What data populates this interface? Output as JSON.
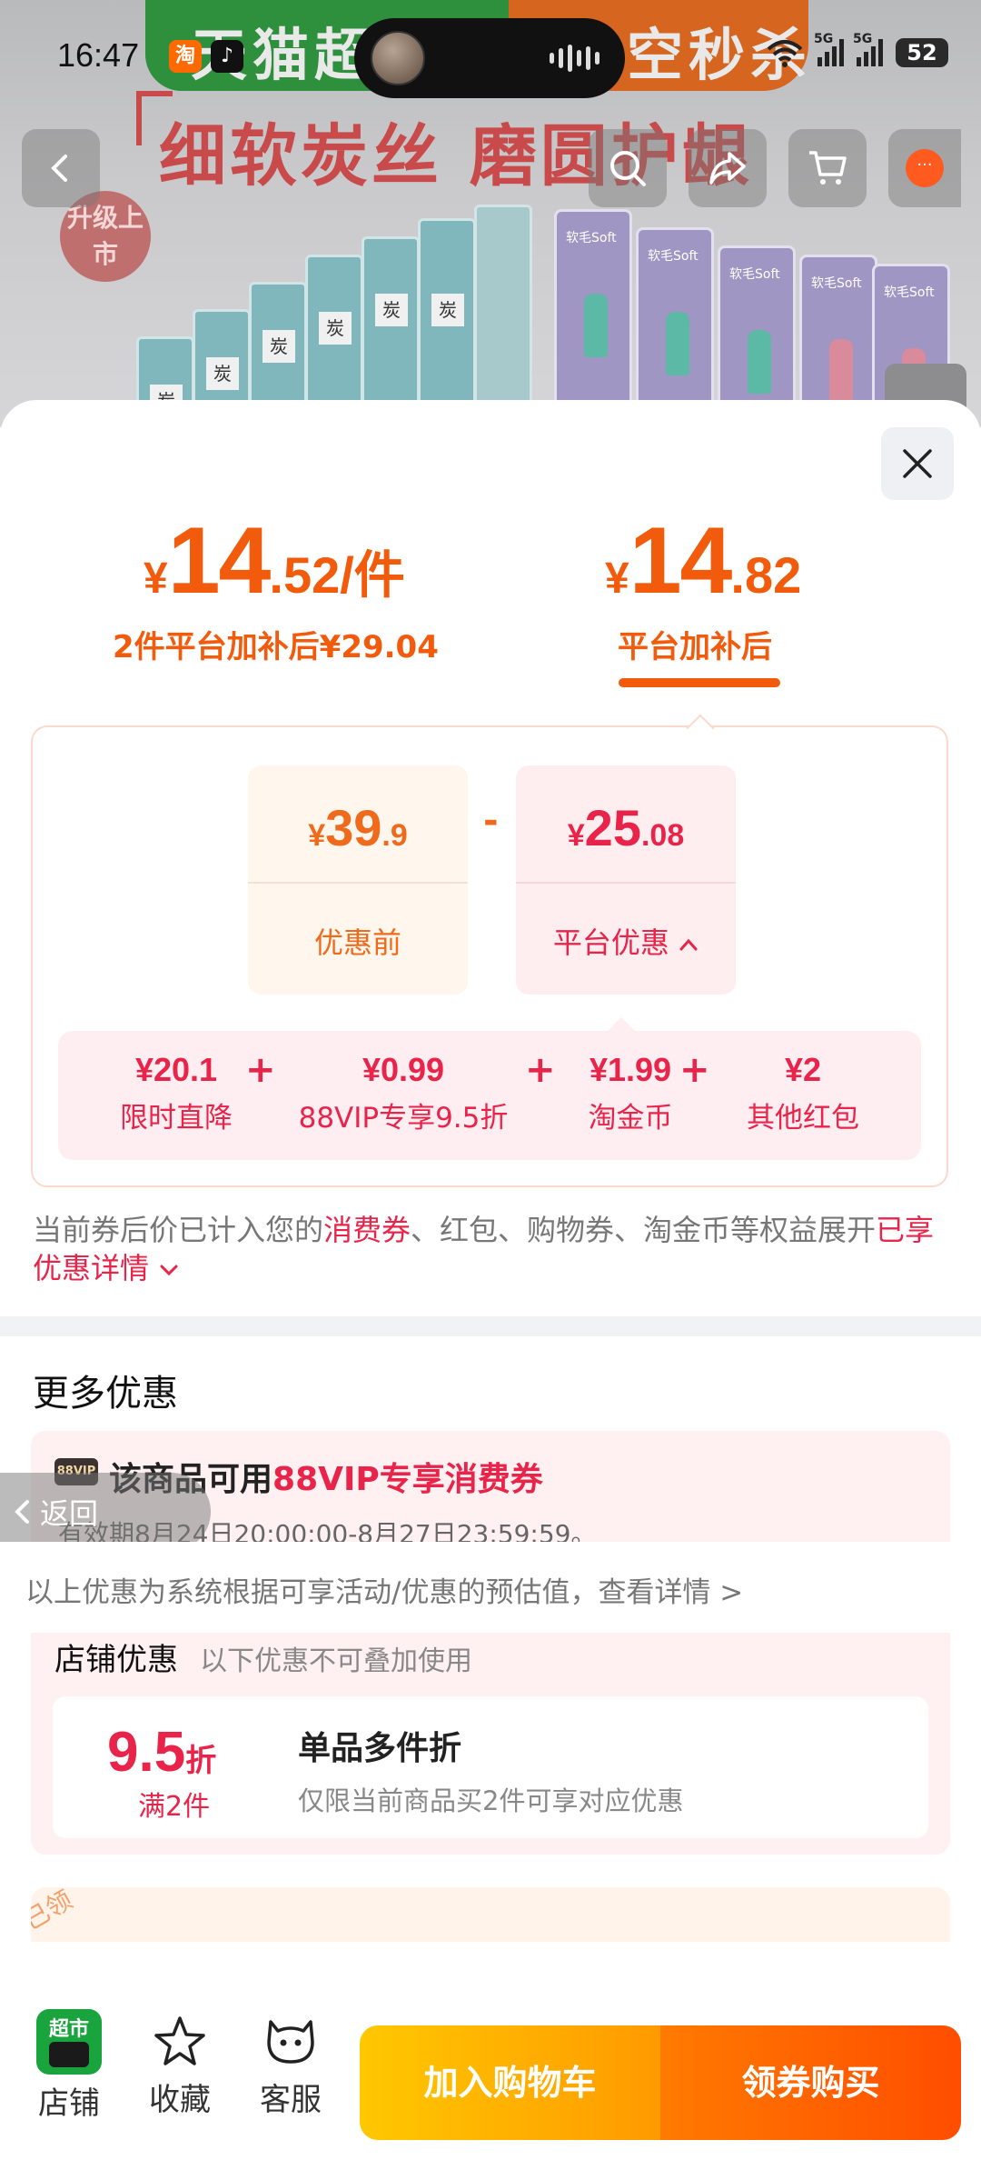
{
  "status_bar": {
    "time": "16:47",
    "battery": "52",
    "network_1": "5G",
    "network_2": "5G"
  },
  "background": {
    "banner_text": "天猫超",
    "banner_text_right": "空秒杀",
    "headline": "细软炭丝 磨圆护龈",
    "badge": "升级上市",
    "pack_label": "软毛Soft",
    "box_label": "炭"
  },
  "price_tabs": {
    "left": {
      "currency": "¥",
      "integer": "14",
      "decimal": ".52/件",
      "subtitle": "2件平台加补后¥29.04"
    },
    "right": {
      "currency": "¥",
      "integer": "14",
      "decimal": ".82",
      "subtitle": "平台加补后"
    }
  },
  "calculation": {
    "before": {
      "currency": "¥",
      "integer": "39",
      "decimal": ".9",
      "label": "优惠前"
    },
    "operator": "-",
    "platform": {
      "currency": "¥",
      "integer": "25",
      "decimal": ".08",
      "label": "平台优惠"
    },
    "breakdown": [
      {
        "value": "¥20.1",
        "label": "限时直降"
      },
      {
        "value": "¥0.99",
        "label": "88VIP专享9.5折"
      },
      {
        "value": "¥1.99",
        "label": "淘金币"
      },
      {
        "value": "¥2",
        "label": "其他红包"
      }
    ],
    "plus": "+"
  },
  "note": {
    "part1": "当前券后价已计入您的",
    "highlight1": "消费券",
    "part2": "、红包、购物券、淘金币等权益展开",
    "link": "已享优惠详情"
  },
  "more_offers": {
    "title": "更多优惠",
    "vip": {
      "badge": "88VIP",
      "title_prefix": "该商品可用",
      "title_highlight": "88VIP专享消费券",
      "validity": "有效期8月24日20:00:00-8月27日23:59:59。"
    },
    "shop": {
      "title": "店铺优惠",
      "subtitle": "以下优惠不可叠加使用",
      "discount_value": "9.5",
      "discount_unit": "折",
      "discount_condition": "满2件",
      "discount_name": "单品多件折",
      "discount_desc": "仅限当前商品买2件可享对应优惠"
    },
    "peek_tag": "已领"
  },
  "return_label": "返回",
  "disclaimer": "以上优惠为系统根据可享活动/优惠的预估值，查看详情 >",
  "bottom_bar": {
    "shop_logo_text": "超市",
    "shop_label": "店铺",
    "favorite_label": "收藏",
    "service_label": "客服",
    "add_cart": "加入购物车",
    "buy": "领券购买"
  },
  "colors": {
    "orange": "#f25a0c",
    "red": "#e8244a",
    "cart_gradient": "#ffc800",
    "buy_gradient": "#ff4d00"
  }
}
